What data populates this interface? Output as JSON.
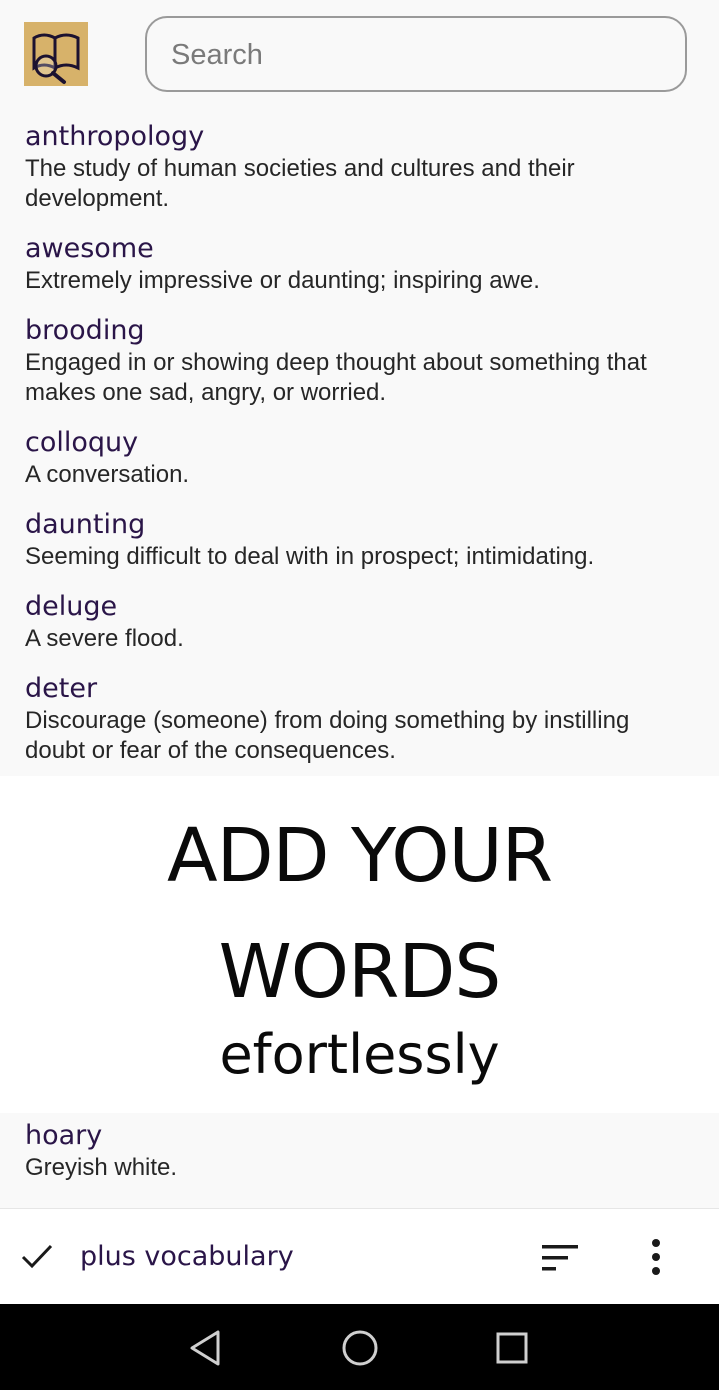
{
  "header": {
    "logo_icon": "book-magnifier-icon",
    "search_placeholder": "Search"
  },
  "entries": [
    {
      "word": "anthropology",
      "definition": "The study of human societies and cultures and their development."
    },
    {
      "word": "awesome",
      "definition": "Extremely impressive or daunting; inspiring awe."
    },
    {
      "word": "brooding",
      "definition": "Engaged in or showing deep thought about something that makes one sad, angry, or worried."
    },
    {
      "word": "colloquy",
      "definition": "A conversation."
    },
    {
      "word": "daunting",
      "definition": "Seeming difficult to deal with in prospect; intimidating."
    },
    {
      "word": "deluge",
      "definition": "A severe flood."
    },
    {
      "word": "deter",
      "definition": "Discourage (someone) from doing something by instilling doubt or fear of the consequences."
    }
  ],
  "banner": {
    "line1": "ADD YOUR",
    "line2": "WORDS",
    "line3": "efortlessly"
  },
  "entries_below": [
    {
      "word": "hoary",
      "definition": "Greyish white."
    }
  ],
  "bottom_bar": {
    "check_icon": "check-icon",
    "app_name": "plus vocabulary",
    "sort_icon": "sort-icon",
    "more_icon": "more-vert-icon"
  },
  "nav": {
    "back_icon": "back-triangle-icon",
    "home_icon": "home-circle-icon",
    "recents_icon": "recents-square-icon"
  },
  "colors": {
    "word": "#2a1548",
    "definition": "#262626",
    "logo_bg": "#d7b26a",
    "background": "#f9f9f9"
  }
}
